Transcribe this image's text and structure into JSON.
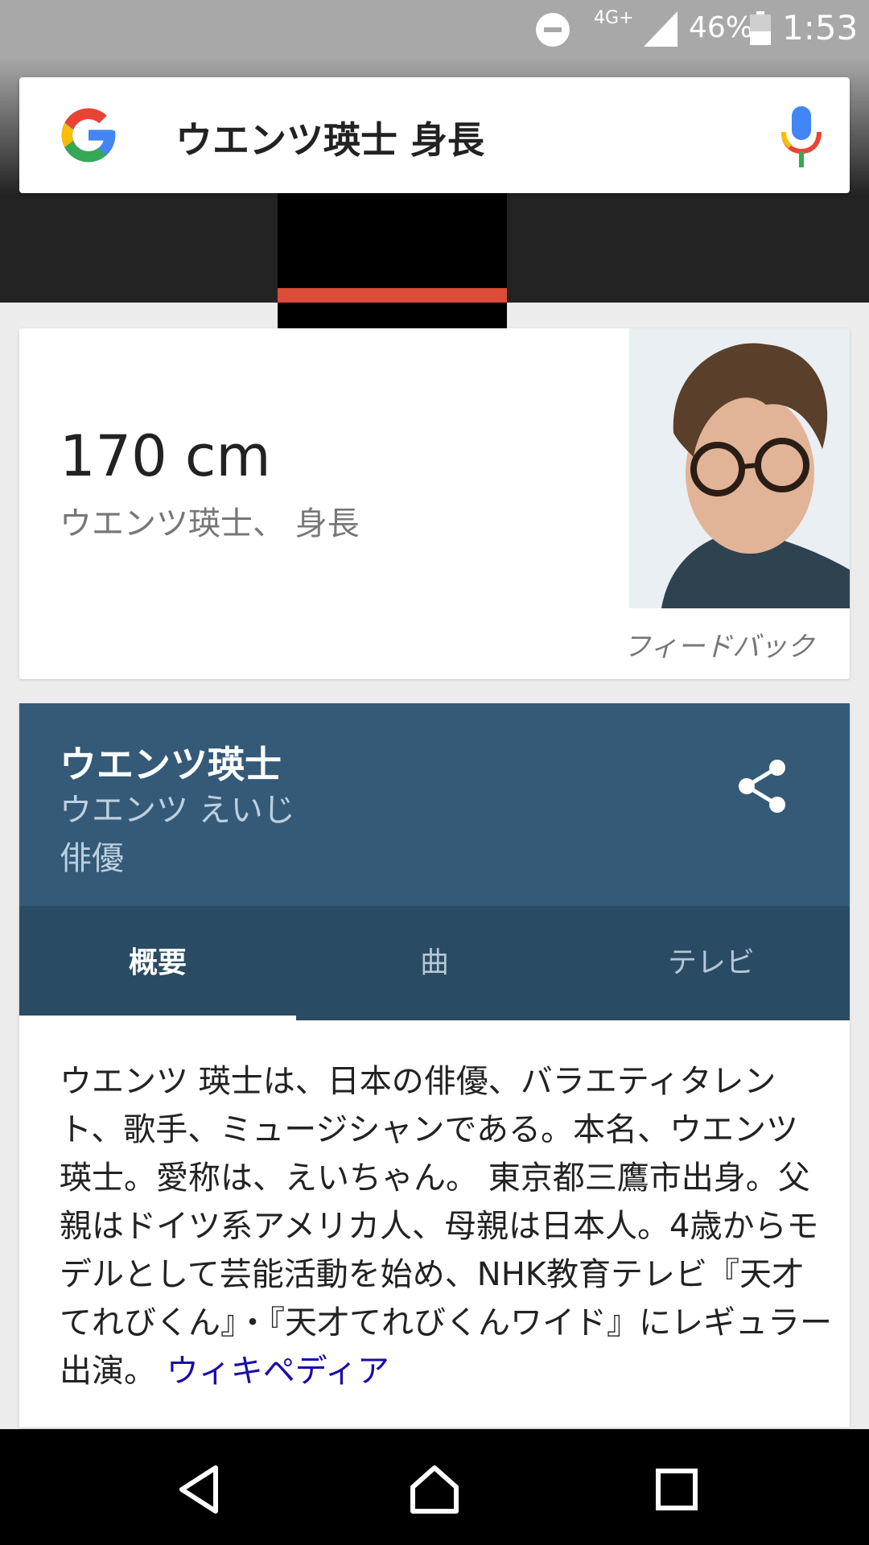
{
  "status_bar": {
    "network": "4G+",
    "battery_percent": "46%",
    "battery_level": 0.46,
    "time": "1:53",
    "icons": [
      "do-not-disturb-icon",
      "signal-icon",
      "battery-icon"
    ]
  },
  "search": {
    "query": "ウエンツ瑛士 身長",
    "icons": [
      "google-logo-icon",
      "microphone-icon"
    ]
  },
  "answer": {
    "value": "170 cm",
    "description": "ウエンツ瑛士、 身長",
    "feedback_label": "フィードバック"
  },
  "knowledge_panel": {
    "name": "ウエンツ瑛士",
    "reading": "ウエンツ えいじ",
    "role": "俳優",
    "share_icon": "share-icon",
    "colors": {
      "header": "#345a78",
      "tabs": "#2a4b64"
    },
    "tabs": [
      {
        "label": "概要",
        "active": true
      },
      {
        "label": "曲",
        "active": false
      },
      {
        "label": "テレビ",
        "active": false
      }
    ],
    "summary": "ウエンツ 瑛士は、日本の俳優、バラエティタレント、歌手、ミュージシャンである。本名、ウエンツ 瑛士。愛称は、えいちゃん。 東京都三鷹市出身。父親はドイツ系アメリカ人、母親は日本人。4歳からモデルとして芸能活動を始め、NHK教育テレビ『天才てれびくん』・『天才てれびくんワイド』にレギュラー出演。",
    "source_link": "ウィキペディア"
  },
  "navigation": {
    "icons": [
      "back-icon",
      "home-icon",
      "recents-icon"
    ]
  }
}
